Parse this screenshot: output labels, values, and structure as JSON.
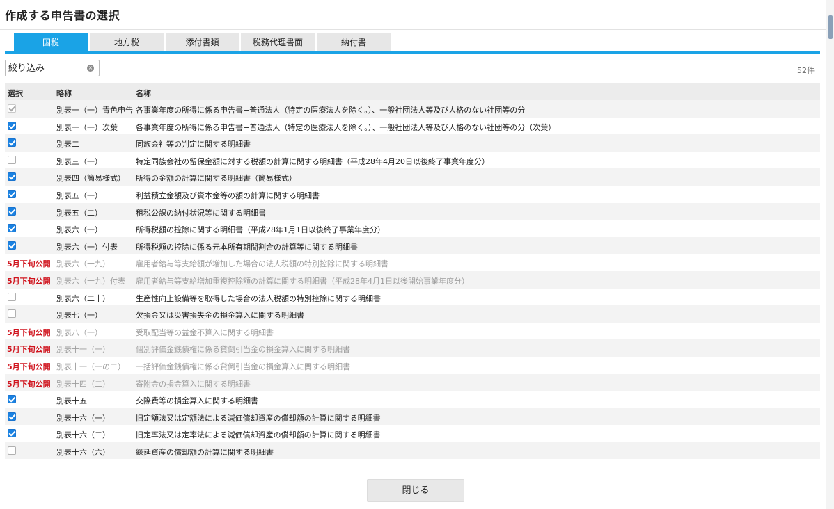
{
  "dialog": {
    "title": "作成する申告書の選択"
  },
  "tabs": [
    {
      "label": "国税",
      "active": true
    },
    {
      "label": "地方税",
      "active": false
    },
    {
      "label": "添付書類",
      "active": false
    },
    {
      "label": "税務代理書面",
      "active": false
    },
    {
      "label": "納付書",
      "active": false
    }
  ],
  "filter": {
    "placeholder": "絞り込み"
  },
  "count": "52件",
  "table": {
    "headers": {
      "select": "選択",
      "abbr": "略称",
      "name": "名称"
    },
    "rows": [
      {
        "state": "checked-disabled",
        "pending": "",
        "abbr": "別表一（一）青色申告",
        "name": "各事業年度の所得に係る申告書−普通法人（特定の医療法人を除く。）、一般社団法人等及び人格のない社団等の分"
      },
      {
        "state": "checked",
        "pending": "",
        "abbr": "別表一（一）次葉",
        "name": "各事業年度の所得に係る申告書−普通法人（特定の医療法人を除く。）、一般社団法人等及び人格のない社団等の分（次葉）"
      },
      {
        "state": "checked",
        "pending": "",
        "abbr": "別表二",
        "name": "同族会社等の判定に関する明細書"
      },
      {
        "state": "unchecked",
        "pending": "",
        "abbr": "別表三（一）",
        "name": "特定同族会社の留保金額に対する税額の計算に関する明細書（平成28年4月20日以後終了事業年度分）"
      },
      {
        "state": "checked",
        "pending": "",
        "abbr": "別表四（簡易様式）",
        "name": "所得の金額の計算に関する明細書（簡易様式）"
      },
      {
        "state": "checked",
        "pending": "",
        "abbr": "別表五（一）",
        "name": "利益積立金額及び資本金等の額の計算に関する明細書"
      },
      {
        "state": "checked",
        "pending": "",
        "abbr": "別表五（二）",
        "name": "租税公課の納付状況等に関する明細書"
      },
      {
        "state": "checked",
        "pending": "",
        "abbr": "別表六（一）",
        "name": "所得税額の控除に関する明細書（平成28年1月1日以後終了事業年度分）"
      },
      {
        "state": "checked",
        "pending": "",
        "abbr": "別表六（一）付表",
        "name": "所得税額の控除に係る元本所有期間割合の計算等に関する明細書"
      },
      {
        "state": "pending",
        "pending": "5月下旬公開",
        "abbr": "別表六（十九）",
        "name": "雇用者給与等支給額が増加した場合の法人税額の特別控除に関する明細書"
      },
      {
        "state": "pending",
        "pending": "5月下旬公開",
        "abbr": "別表六（十九）付表",
        "name": "雇用者給与等支給増加重複控除額の計算に関する明細書（平成28年4月1日以後開始事業年度分）"
      },
      {
        "state": "unchecked",
        "pending": "",
        "abbr": "別表六（二十）",
        "name": "生産性向上設備等を取得した場合の法人税額の特別控除に関する明細書"
      },
      {
        "state": "unchecked",
        "pending": "",
        "abbr": "別表七（一）",
        "name": "欠損金又は災害損失金の損金算入に関する明細書"
      },
      {
        "state": "pending",
        "pending": "5月下旬公開",
        "abbr": "別表八（一）",
        "name": "受取配当等の益金不算入に関する明細書"
      },
      {
        "state": "pending",
        "pending": "5月下旬公開",
        "abbr": "別表十一（一）",
        "name": "個別評価金銭債権に係る貸倒引当金の損金算入に関する明細書"
      },
      {
        "state": "pending",
        "pending": "5月下旬公開",
        "abbr": "別表十一（一の二）",
        "name": "一括評価金銭債権に係る貸倒引当金の損金算入に関する明細書"
      },
      {
        "state": "pending",
        "pending": "5月下旬公開",
        "abbr": "別表十四（二）",
        "name": "寄附金の損金算入に関する明細書"
      },
      {
        "state": "checked",
        "pending": "",
        "abbr": "別表十五",
        "name": "交際費等の損金算入に関する明細書"
      },
      {
        "state": "checked",
        "pending": "",
        "abbr": "別表十六（一）",
        "name": "旧定額法又は定額法による減価償却資産の償却額の計算に関する明細書"
      },
      {
        "state": "checked",
        "pending": "",
        "abbr": "別表十六（二）",
        "name": "旧定率法又は定率法による減価償却資産の償却額の計算に関する明細書"
      },
      {
        "state": "unchecked",
        "pending": "",
        "abbr": "別表十六（六）",
        "name": "繰延資産の償却額の計算に関する明細書"
      }
    ]
  },
  "footer": {
    "close_label": "閉じる"
  },
  "colors": {
    "accent": "#1aa3e6",
    "checkbox": "#1a82e2",
    "pending": "#d0141e"
  },
  "icons": {
    "clear": "clear-circle-icon"
  }
}
